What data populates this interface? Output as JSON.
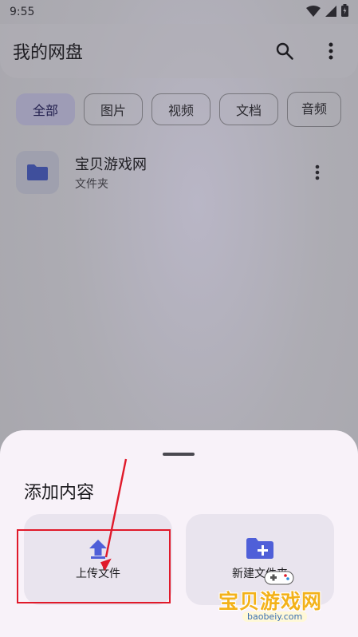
{
  "status_bar": {
    "time": "9:55",
    "icons": [
      "wifi-icon",
      "signal-icon",
      "battery-icon"
    ]
  },
  "app_bar": {
    "title": "我的网盘",
    "actions": [
      "search-icon",
      "more-vert-icon"
    ]
  },
  "filter_chips": [
    {
      "label": "全部",
      "selected": true
    },
    {
      "label": "图片",
      "selected": false
    },
    {
      "label": "视频",
      "selected": false
    },
    {
      "label": "文档",
      "selected": false
    },
    {
      "label": "音频",
      "selected": false
    }
  ],
  "files": [
    {
      "name": "宝贝游戏网",
      "type": "文件夹",
      "icon": "folder-icon"
    }
  ],
  "sheet": {
    "title": "添加内容",
    "upload": {
      "label": "上传文件",
      "icon": "upload-icon"
    },
    "new_folder": {
      "label": "新建文件夹",
      "icon": "create-folder-icon"
    }
  },
  "watermark": {
    "text": "宝贝游戏网",
    "url": "baobeiy.com"
  },
  "colors": {
    "accent": "#4f5fd8",
    "chip_selected_bg": "#9e9cb6",
    "sheet_bg": "#f8f2f9",
    "highlight": "#e0192a",
    "watermark": "#f3b21a"
  }
}
